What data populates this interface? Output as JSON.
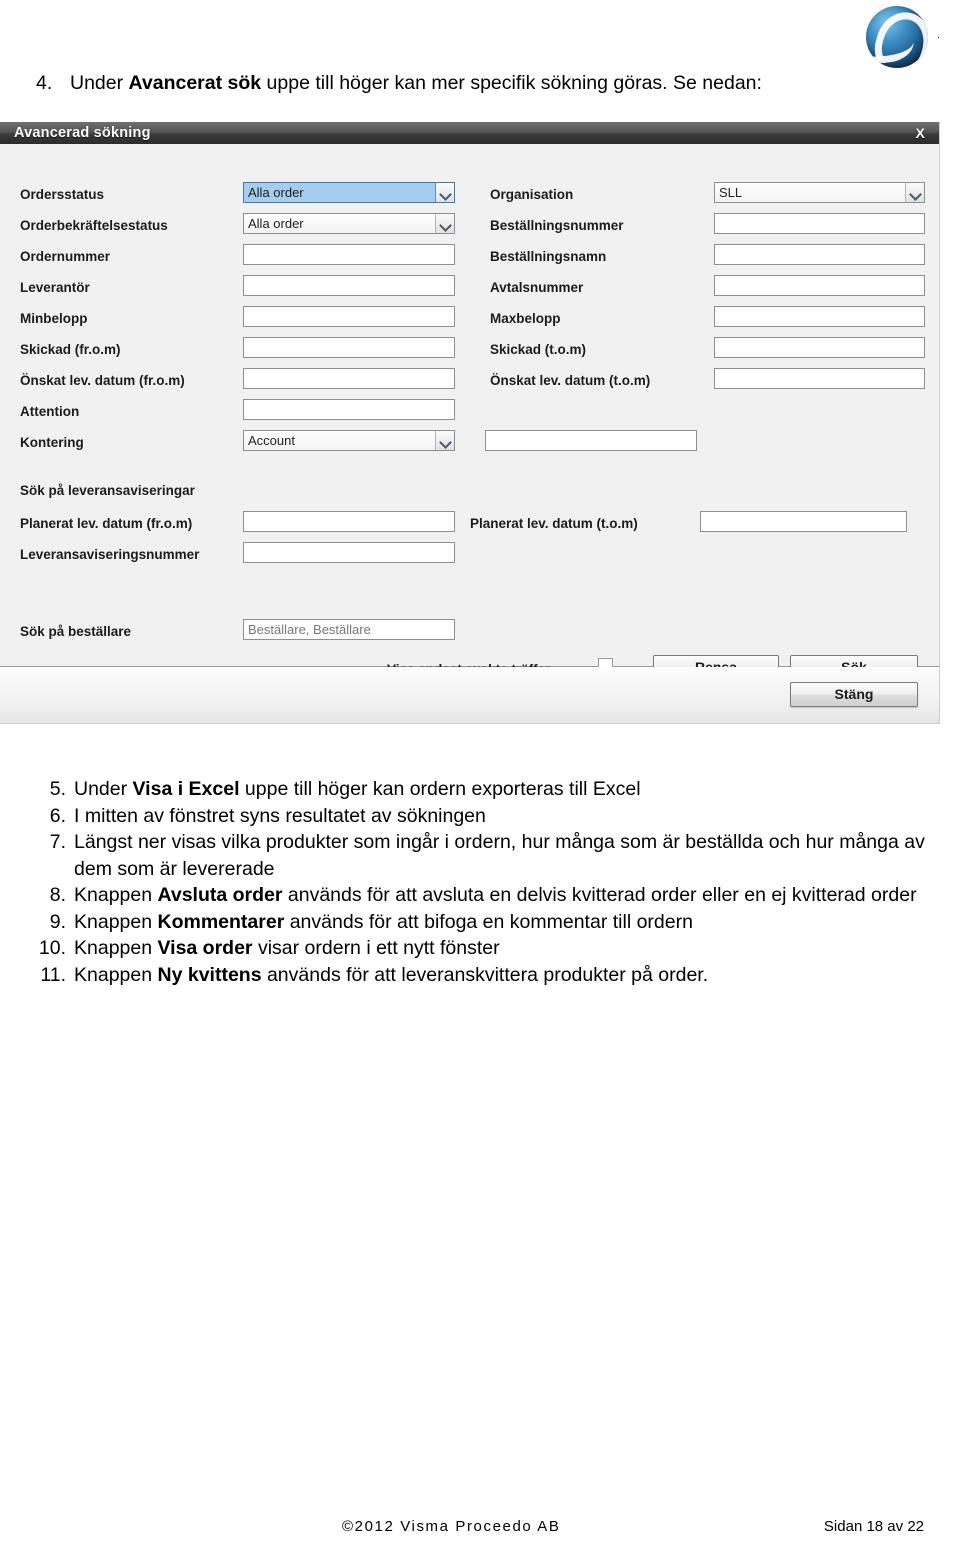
{
  "logo": {
    "name": "visma-proceedo-logo"
  },
  "intro": {
    "number": "4.",
    "text_before": "Under ",
    "bold": "Avancerat sök",
    "text_after": " uppe till höger kan mer specifik sökning göras. Se nedan:"
  },
  "dialog": {
    "title": "Avancerad sökning",
    "close_label": "X",
    "left_fields": [
      {
        "label": "Ordersstatus",
        "type": "select",
        "value": "Alla order",
        "focused": true
      },
      {
        "label": "Orderbekräftelsestatus",
        "type": "select",
        "value": "Alla order",
        "focused": false
      },
      {
        "label": "Ordernummer",
        "type": "text",
        "value": ""
      },
      {
        "label": "Leverantör",
        "type": "text",
        "value": ""
      },
      {
        "label": "Minbelopp",
        "type": "text",
        "value": ""
      },
      {
        "label": "Skickad (fr.o.m)",
        "type": "text",
        "value": ""
      },
      {
        "label": "Önskat lev. datum (fr.o.m)",
        "type": "text",
        "value": ""
      },
      {
        "label": "Attention",
        "type": "text",
        "value": ""
      },
      {
        "label": "Kontering",
        "type": "select",
        "value": "Account",
        "focused": false
      }
    ],
    "kontering_extra_value": "",
    "right_fields": [
      {
        "label": "Organisation",
        "type": "select",
        "value": "SLL",
        "focused": false
      },
      {
        "label": "Beställningsnummer",
        "type": "text",
        "value": ""
      },
      {
        "label": "Beställningsnamn",
        "type": "text",
        "value": ""
      },
      {
        "label": "Avtalsnummer",
        "type": "text",
        "value": ""
      },
      {
        "label": "Maxbelopp",
        "type": "text",
        "value": ""
      },
      {
        "label": "Skickad (t.o.m)",
        "type": "text",
        "value": ""
      },
      {
        "label": "Önskat lev. datum (t.o.m)",
        "type": "text",
        "value": ""
      }
    ],
    "shipment_section": {
      "header": "Sök på leveransaviseringar",
      "planned_from_label": "Planerat lev. datum (fr.o.m)",
      "planned_from_value": "",
      "planned_to_label": "Planerat lev. datum (t.o.m)",
      "planned_to_value": "",
      "despatch_number_label": "Leveransaviseringsnummer",
      "despatch_number_value": ""
    },
    "orderer_section": {
      "label": "Sök på beställare",
      "value": "Beställare, Beställare"
    },
    "exact_match": {
      "label": "Visa endast exakta träffar",
      "checked": false
    },
    "buttons": {
      "clear": "Rensa",
      "search": "Sök",
      "close": "Stäng"
    }
  },
  "steps": [
    {
      "number": "5.",
      "before": "Under ",
      "bold": "Visa i Excel",
      "after": " uppe till höger kan ordern exporteras till Excel"
    },
    {
      "number": "6.",
      "before": "I mitten av fönstret syns resultatet av sökningen",
      "bold": "",
      "after": ""
    },
    {
      "number": "7.",
      "before": "Längst ner visas vilka produkter som ingår i ordern, hur många som är beställda och hur många av dem som är levererade",
      "bold": "",
      "after": ""
    },
    {
      "number": "8.",
      "before": "Knappen ",
      "bold": "Avsluta order",
      "after": " används för att avsluta en delvis kvitterad order eller en ej kvitterad order"
    },
    {
      "number": "9.",
      "before": "Knappen ",
      "bold": "Kommentarer",
      "after": " används för att bifoga en kommentar till ordern"
    },
    {
      "number": "10.",
      "before": "Knappen ",
      "bold": "Visa order",
      "after": " visar ordern i ett nytt fönster"
    },
    {
      "number": "11.",
      "before": "Knappen ",
      "bold": "Ny kvittens",
      "after": " används för att leveranskvittera produkter på order."
    }
  ],
  "footer": {
    "copyright": "©2012 Visma Proceedo AB",
    "page": "Sidan 18 av 22"
  }
}
